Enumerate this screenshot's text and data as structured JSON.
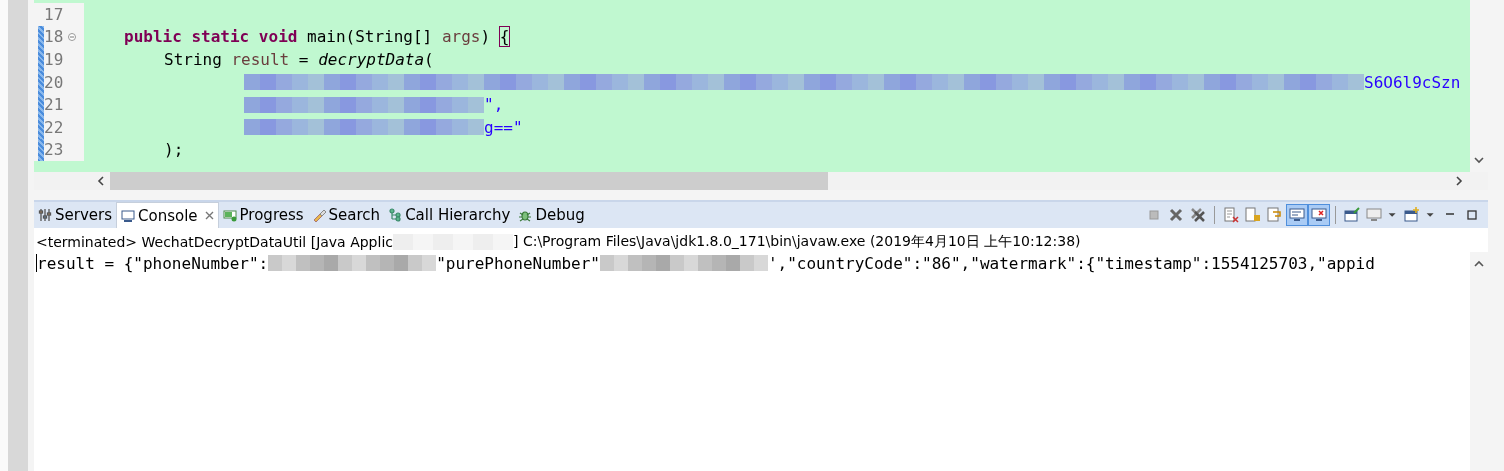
{
  "editor": {
    "lines": [
      {
        "number": "17",
        "changed": false,
        "folder": false,
        "kind": "blank"
      },
      {
        "number": "18",
        "changed": true,
        "folder": true,
        "kind": "member",
        "segments": [
          {
            "kind": "keyword",
            "text": "public static void"
          },
          {
            "kind": "plain",
            "text": " main(String[] "
          },
          {
            "kind": "var",
            "text": "args"
          },
          {
            "kind": "plain",
            "text": ") "
          },
          {
            "kind": "bracket",
            "text": "{"
          }
        ]
      },
      {
        "number": "19",
        "changed": true,
        "folder": false,
        "kind": "statement",
        "segments": [
          {
            "kind": "plain",
            "text": "String "
          },
          {
            "kind": "var",
            "text": "result"
          },
          {
            "kind": "plain",
            "text": " = "
          },
          {
            "kind": "method",
            "text": "decryptData"
          },
          {
            "kind": "plain",
            "text": "("
          }
        ]
      },
      {
        "number": "20",
        "changed": true,
        "folder": false,
        "kind": "argument",
        "segments": [
          {
            "kind": "redaction-long"
          },
          {
            "kind": "string",
            "text": "S6O6l9cSzn"
          }
        ]
      },
      {
        "number": "21",
        "changed": true,
        "folder": false,
        "kind": "argument",
        "segments": [
          {
            "kind": "redaction-short"
          },
          {
            "kind": "string",
            "text": "\","
          }
        ]
      },
      {
        "number": "22",
        "changed": true,
        "folder": false,
        "kind": "argument",
        "segments": [
          {
            "kind": "redaction-short"
          },
          {
            "kind": "string",
            "text": "g==\""
          }
        ]
      },
      {
        "number": "23",
        "changed": true,
        "folder": false,
        "kind": "statement",
        "segments": [
          {
            "kind": "plain",
            "text": ");"
          }
        ]
      }
    ]
  },
  "tabs": [
    {
      "label": "Servers",
      "kind": "servers",
      "selected": false
    },
    {
      "label": "Console",
      "kind": "console",
      "selected": true
    },
    {
      "label": "Progress",
      "kind": "progress",
      "selected": false
    },
    {
      "label": "Search",
      "kind": "search",
      "selected": false
    },
    {
      "label": "Call Hierarchy",
      "kind": "hierarchy",
      "selected": false
    },
    {
      "label": "Debug",
      "kind": "debug",
      "selected": false
    }
  ],
  "toolbar": [
    {
      "kind": "terminate",
      "selected": false,
      "separator_before": false
    },
    {
      "kind": "remove",
      "selected": false,
      "separator_before": false
    },
    {
      "kind": "remove-all",
      "selected": false,
      "separator_before": false
    },
    {
      "kind": "clear",
      "selected": false,
      "separator_before": true
    },
    {
      "kind": "scroll-lock",
      "selected": false,
      "separator_before": false
    },
    {
      "kind": "word-wrap",
      "selected": false,
      "separator_before": false
    },
    {
      "kind": "show-out",
      "selected": true,
      "separator_before": false
    },
    {
      "kind": "show-err",
      "selected": true,
      "separator_before": false
    },
    {
      "kind": "pin",
      "selected": false,
      "separator_before": true
    },
    {
      "kind": "display",
      "selected": false,
      "separator_before": false
    },
    {
      "kind": "caret",
      "selected": false,
      "separator_before": false
    },
    {
      "kind": "new-console",
      "selected": false,
      "separator_before": false
    },
    {
      "kind": "caret",
      "selected": false,
      "separator_before": false
    },
    {
      "kind": "minimize",
      "selected": false,
      "separator_before": false
    },
    {
      "kind": "maximize",
      "selected": false,
      "separator_before": false
    }
  ],
  "console": {
    "header_before": "<terminated> WechatDecryptDataUtil [Java Applic",
    "header_after": "] C:\\Program Files\\Java\\jdk1.8.0_171\\bin\\javaw.exe (2019年4月10日 上午10:12:38)",
    "output": [
      {
        "kind": "text",
        "text": "result = {\"phoneNumber\":"
      },
      {
        "kind": "redaction"
      },
      {
        "kind": "text",
        "text": "\"purePhoneNumber\""
      },
      {
        "kind": "redaction"
      },
      {
        "kind": "text",
        "text": "',\"countryCode\":\"86\",\"watermark\":{\"timestamp\":1554125703,\"appid"
      }
    ]
  }
}
